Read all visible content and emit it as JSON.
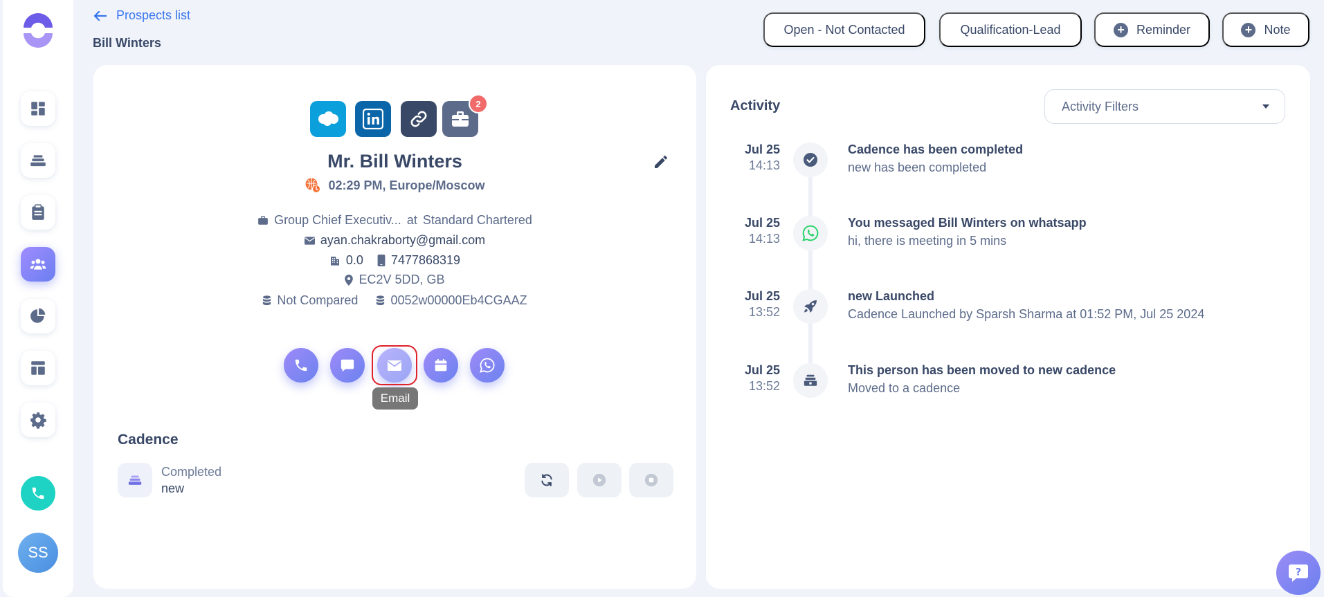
{
  "header": {
    "back_label": "Prospects list",
    "prospect_name": "Bill Winters",
    "status_button": "Open - Not Contacted",
    "qualification_button": "Qualification-Lead",
    "reminder_button": "Reminder",
    "note_button": "Note"
  },
  "sidebar": {
    "avatar_initials": "SS",
    "items": [
      "dashboard-icon",
      "cadence-stack-icon",
      "tasks-clipboard-icon",
      "people-icon",
      "pie-chart-icon",
      "layout-template-icon",
      "gear-icon"
    ],
    "active_item": "people-icon"
  },
  "profile": {
    "integration_badge_count": "2",
    "full_name": "Mr. Bill Winters",
    "local_time": "02:29 PM, Europe/Moscow",
    "job_title": "Group Chief Executiv...",
    "at_label": "at",
    "company": "Standard Chartered",
    "email": "ayan.chakraborty@gmail.com",
    "company_phone": "0.0",
    "mobile_phone": "7477868319",
    "location": "EC2V 5DD, GB",
    "compare_status": "Not Compared",
    "crm_id": "0052w00000Eb4CGAAZ"
  },
  "actions": {
    "tooltip": "Email",
    "items": [
      "phone-icon",
      "chat-icon",
      "email-icon",
      "calendar-icon",
      "whatsapp-icon"
    ]
  },
  "cadence": {
    "title": "Cadence",
    "status": "Completed",
    "name": "new"
  },
  "activity": {
    "title": "Activity",
    "filter_placeholder": "Activity Filters",
    "items": [
      {
        "date": "Jul 25",
        "time": "14:13",
        "title": "Cadence has been completed",
        "subtitle": "new has been completed",
        "icon": "check-circle-icon"
      },
      {
        "date": "Jul 25",
        "time": "14:13",
        "title": "You messaged Bill Winters on whatsapp",
        "subtitle": "hi, there is meeting in 5 mins",
        "icon": "whatsapp-icon"
      },
      {
        "date": "Jul 25",
        "time": "13:52",
        "title": "new Launched",
        "subtitle": "Cadence Launched by Sparsh Sharma at 01:52 PM, Jul 25 2024",
        "icon": "rocket-icon"
      },
      {
        "date": "Jul 25",
        "time": "13:52",
        "title": "This person has been moved to new cadence",
        "subtitle": "Moved to a cadence",
        "icon": "cadence-move-icon"
      }
    ]
  },
  "colors": {
    "accent": "#3874ef",
    "action_gradient_start": "#9d8af8",
    "action_gradient_end": "#6c83ef",
    "call_fab": "#1ed3c4",
    "badge": "#f16b6b",
    "salesforce": "#0ba0dc",
    "linkedin": "#0a66a8",
    "whatsapp": "#25d366"
  }
}
